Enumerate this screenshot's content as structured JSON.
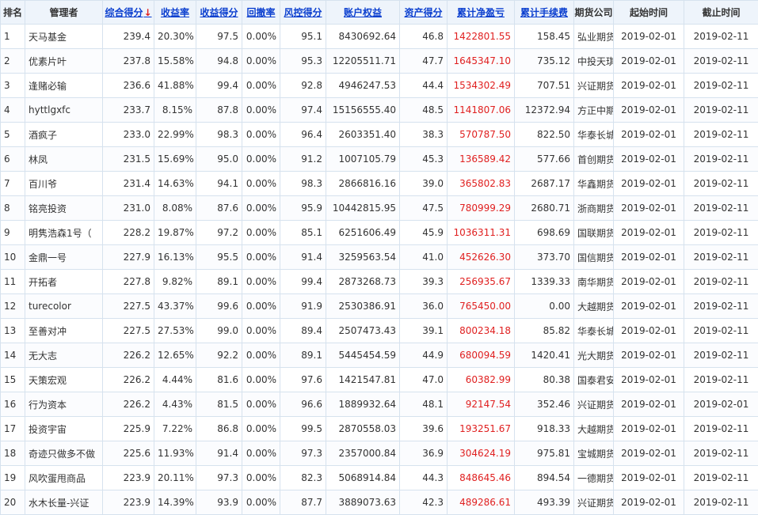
{
  "headers": {
    "rank": "排名",
    "manager": "管理者",
    "composite": "综合得分",
    "composite_arrow": "↓",
    "return_rate": "收益率",
    "return_score": "收益得分",
    "drawdown": "回撤率",
    "risk_score": "风控得分",
    "equity": "账户权益",
    "asset_score": "资产得分",
    "net_pnl": "累计净盈亏",
    "fee": "累计手续费",
    "broker": "期货公司",
    "start": "起始时间",
    "end": "截止时间"
  },
  "colors": {
    "header_bg": "#eef4fb",
    "link": "#0b3fcf",
    "profit": "#e02020",
    "border": "#d6e2ee"
  },
  "rows": [
    [
      "1",
      "天马基金",
      "239.4",
      "20.30%",
      "97.5",
      "0.00%",
      "95.1",
      "8430692.64",
      "46.8",
      "1422801.55",
      "158.45",
      "弘业期货",
      "2019-02-01",
      "2019-02-11"
    ],
    [
      "2",
      "优素片叶",
      "237.8",
      "15.58%",
      "94.8",
      "0.00%",
      "95.3",
      "12205511.71",
      "47.7",
      "1645347.10",
      "735.12",
      "中投天琪",
      "2019-02-01",
      "2019-02-11"
    ],
    [
      "3",
      "逢赌必输",
      "236.6",
      "41.88%",
      "99.4",
      "0.00%",
      "92.8",
      "4946247.53",
      "44.4",
      "1534302.49",
      "707.51",
      "兴证期货",
      "2019-02-01",
      "2019-02-11"
    ],
    [
      "4",
      "hyttlgxfc",
      "233.7",
      "8.15%",
      "87.8",
      "0.00%",
      "97.4",
      "15156555.40",
      "48.5",
      "1141807.06",
      "12372.94",
      "方正中期",
      "2019-02-01",
      "2019-02-11"
    ],
    [
      "5",
      "酒疯子",
      "233.0",
      "22.99%",
      "98.3",
      "0.00%",
      "96.4",
      "2603351.40",
      "38.3",
      "570787.50",
      "822.50",
      "华泰长城",
      "2019-02-01",
      "2019-02-11"
    ],
    [
      "6",
      "林凤",
      "231.5",
      "15.69%",
      "95.0",
      "0.00%",
      "91.2",
      "1007105.79",
      "45.3",
      "136589.42",
      "577.66",
      "首创期货",
      "2019-02-01",
      "2019-02-11"
    ],
    [
      "7",
      "百川爷",
      "231.4",
      "14.63%",
      "94.1",
      "0.00%",
      "98.3",
      "2866816.16",
      "39.0",
      "365802.83",
      "2687.17",
      "华鑫期货",
      "2019-02-01",
      "2019-02-11"
    ],
    [
      "8",
      "铭亮投资",
      "231.0",
      "8.08%",
      "87.6",
      "0.00%",
      "95.9",
      "10442815.95",
      "47.5",
      "780999.29",
      "2680.71",
      "浙商期货",
      "2019-02-01",
      "2019-02-11"
    ],
    [
      "9",
      "明隽浩森1号（",
      "228.2",
      "19.87%",
      "97.2",
      "0.00%",
      "85.1",
      "6251606.49",
      "45.9",
      "1036311.31",
      "698.69",
      "国联期货",
      "2019-02-01",
      "2019-02-11"
    ],
    [
      "10",
      "金鼎一号",
      "227.9",
      "16.13%",
      "95.5",
      "0.00%",
      "91.4",
      "3259563.54",
      "41.0",
      "452626.30",
      "373.70",
      "国信期货",
      "2019-02-01",
      "2019-02-11"
    ],
    [
      "11",
      "开拓者",
      "227.8",
      "9.82%",
      "89.1",
      "0.00%",
      "99.4",
      "2873268.73",
      "39.3",
      "256935.67",
      "1339.33",
      "南华期货",
      "2019-02-01",
      "2019-02-11"
    ],
    [
      "12",
      "turecolor",
      "227.5",
      "43.37%",
      "99.6",
      "0.00%",
      "91.9",
      "2530386.91",
      "36.0",
      "765450.00",
      "0.00",
      "大越期货",
      "2019-02-01",
      "2019-02-11"
    ],
    [
      "13",
      "至善对冲",
      "227.5",
      "27.53%",
      "99.0",
      "0.00%",
      "89.4",
      "2507473.43",
      "39.1",
      "800234.18",
      "85.82",
      "华泰长城",
      "2019-02-01",
      "2019-02-11"
    ],
    [
      "14",
      "无大志",
      "226.2",
      "12.65%",
      "92.2",
      "0.00%",
      "89.1",
      "5445454.59",
      "44.9",
      "680094.59",
      "1420.41",
      "光大期货",
      "2019-02-01",
      "2019-02-11"
    ],
    [
      "15",
      "天策宏观",
      "226.2",
      "4.44%",
      "81.6",
      "0.00%",
      "97.6",
      "1421547.81",
      "47.0",
      "60382.99",
      "80.38",
      "国泰君安",
      "2019-02-01",
      "2019-02-11"
    ],
    [
      "16",
      "行为资本",
      "226.2",
      "4.43%",
      "81.5",
      "0.00%",
      "96.6",
      "1889932.64",
      "48.1",
      "92147.54",
      "352.46",
      "兴证期货",
      "2019-02-01",
      "2019-02-01"
    ],
    [
      "17",
      "投资宇宙",
      "225.9",
      "7.22%",
      "86.8",
      "0.00%",
      "99.5",
      "2870558.03",
      "39.6",
      "193251.67",
      "918.33",
      "大越期货",
      "2019-02-01",
      "2019-02-11"
    ],
    [
      "18",
      "奇迹只做多不做",
      "225.6",
      "11.93%",
      "91.4",
      "0.00%",
      "97.3",
      "2357000.84",
      "36.9",
      "304624.19",
      "975.81",
      "宝城期货",
      "2019-02-01",
      "2019-02-11"
    ],
    [
      "19",
      "风吹蛋甩商品",
      "223.9",
      "20.11%",
      "97.3",
      "0.00%",
      "82.3",
      "5068914.84",
      "44.3",
      "848645.46",
      "894.54",
      "一德期货",
      "2019-02-01",
      "2019-02-11"
    ],
    [
      "20",
      "水木长量-兴证",
      "223.9",
      "14.39%",
      "93.9",
      "0.00%",
      "87.7",
      "3889073.63",
      "42.3",
      "489286.61",
      "493.39",
      "兴证期货",
      "2019-02-01",
      "2019-02-11"
    ]
  ]
}
